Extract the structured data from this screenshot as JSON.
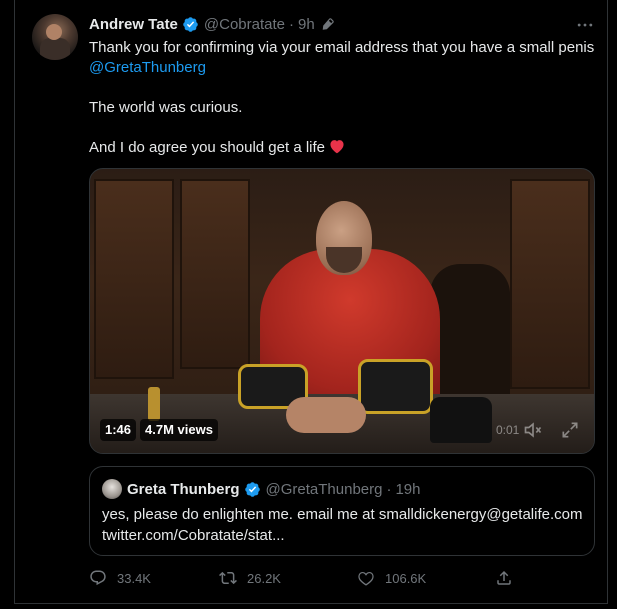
{
  "tweet": {
    "author_name": "Andrew Tate",
    "handle": "@Cobratate",
    "separator": "·",
    "time": "9h",
    "text_line1": "Thank you for confirming via your email address that you have a small penis",
    "mention": "@GretaThunberg",
    "text_line2": "The world was curious.",
    "text_line3": "And I do agree you should get a life",
    "heart_emoji": "red-heart"
  },
  "video": {
    "duration": "1:46",
    "views": "4.7M views",
    "elapsed": "0:01"
  },
  "quote": {
    "author_name": "Greta Thunberg",
    "handle": "@GretaThunberg",
    "separator": "·",
    "time": "19h",
    "text": "yes, please do enlighten me. email me at smalldickenergy@getalife.com",
    "link": "twitter.com/Cobratate/stat..."
  },
  "actions": {
    "replies": "33.4K",
    "retweets": "26.2K",
    "likes": "106.6K"
  },
  "colors": {
    "background": "#000000",
    "text": "#e7e9ea",
    "muted": "#71767b",
    "accent": "#1d9bf0",
    "heart": "#f91880",
    "border": "#2f3336"
  },
  "icons": [
    "verified-badge-icon",
    "edit-icon",
    "more-icon",
    "heart-emoji",
    "mute-icon",
    "expand-icon",
    "reply-icon",
    "retweet-icon",
    "like-icon",
    "share-icon"
  ]
}
